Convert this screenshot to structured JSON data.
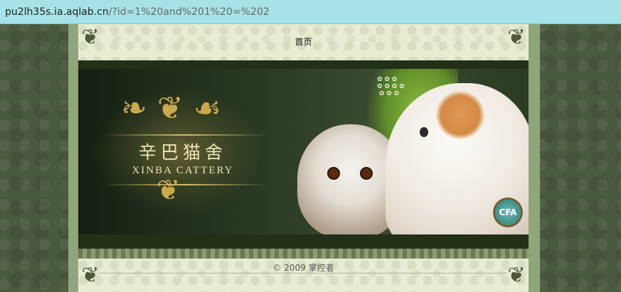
{
  "browser": {
    "url_host": "pu2lh35s.ia.aqlab.cn",
    "url_path": "/?id=1%20and%201%20=%202"
  },
  "nav": {
    "items": [
      {
        "label": "首页"
      }
    ]
  },
  "banner": {
    "title_cn": "辛巴猫舍",
    "title_en": "XINBA CATTERY",
    "badge_text": "CFA",
    "colors": {
      "gold": "#c9a94c",
      "dark_green": "#223018",
      "text_cream": "#f0e3b5"
    }
  },
  "footer": {
    "copyright": "© 2009 掌控者"
  },
  "colors": {
    "url_bar": "#a7e3e6",
    "page_bg": "#4a5a3e",
    "content_bg": "#e8ecd2"
  }
}
